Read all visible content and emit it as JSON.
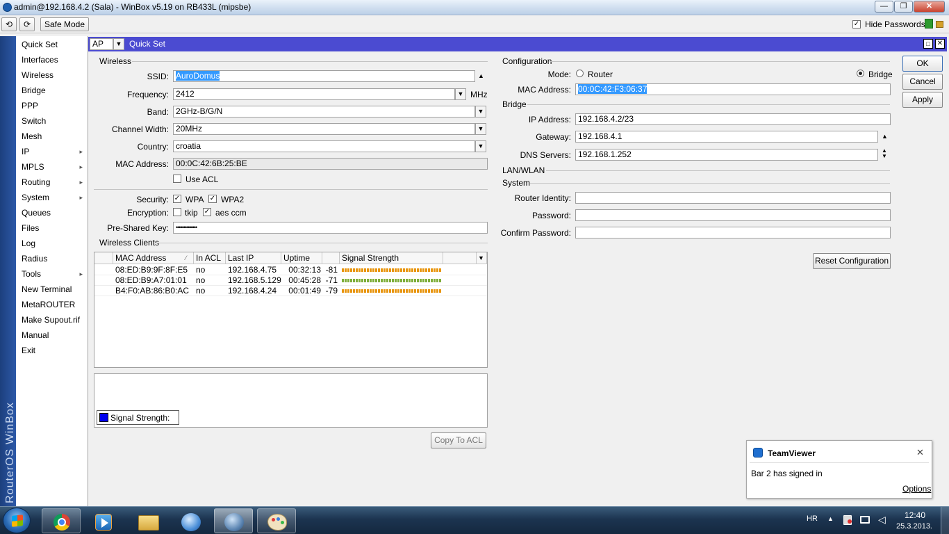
{
  "window": {
    "title": "admin@192.168.4.2 (Sala) - WinBox v5.19 on RB433L (mipsbe)"
  },
  "toolbar": {
    "undo": "⟲",
    "redo": "⟳",
    "safe_mode": "Safe Mode",
    "hide_passwords": "Hide Passwords",
    "hide_passwords_checked": true
  },
  "sidebar": {
    "brand": "RouterOS WinBox",
    "items": [
      {
        "label": "Quick Set",
        "sub": false
      },
      {
        "label": "Interfaces",
        "sub": false
      },
      {
        "label": "Wireless",
        "sub": false
      },
      {
        "label": "Bridge",
        "sub": false
      },
      {
        "label": "PPP",
        "sub": false
      },
      {
        "label": "Switch",
        "sub": false
      },
      {
        "label": "Mesh",
        "sub": false
      },
      {
        "label": "IP",
        "sub": true
      },
      {
        "label": "MPLS",
        "sub": true
      },
      {
        "label": "Routing",
        "sub": true
      },
      {
        "label": "System",
        "sub": true
      },
      {
        "label": "Queues",
        "sub": false
      },
      {
        "label": "Files",
        "sub": false
      },
      {
        "label": "Log",
        "sub": false
      },
      {
        "label": "Radius",
        "sub": false
      },
      {
        "label": "Tools",
        "sub": true
      },
      {
        "label": "New Terminal",
        "sub": false
      },
      {
        "label": "MetaROUTER",
        "sub": false
      },
      {
        "label": "Make Supout.rif",
        "sub": false
      },
      {
        "label": "Manual",
        "sub": false
      },
      {
        "label": "Exit",
        "sub": false
      }
    ]
  },
  "quickset": {
    "mode_select": "AP",
    "title": "Quick Set",
    "buttons": {
      "ok": "OK",
      "cancel": "Cancel",
      "apply": "Apply",
      "reset": "Reset Configuration",
      "copy_acl": "Copy To ACL"
    },
    "wireless": {
      "section": "Wireless",
      "ssid_label": "SSID:",
      "ssid": "AuroDomus",
      "frequency_label": "Frequency:",
      "frequency": "2412",
      "frequency_unit": "MHz",
      "band_label": "Band:",
      "band": "2GHz-B/G/N",
      "channel_width_label": "Channel Width:",
      "channel_width": "20MHz",
      "country_label": "Country:",
      "country": "croatia",
      "mac_label": "MAC Address:",
      "mac": "00:0C:42:6B:25:BE",
      "use_acl": "Use ACL",
      "use_acl_checked": false,
      "security_label": "Security:",
      "wpa": "WPA",
      "wpa_checked": true,
      "wpa2": "WPA2",
      "wpa2_checked": true,
      "encryption_label": "Encryption:",
      "tkip": "tkip",
      "tkip_checked": false,
      "aes": "aes ccm",
      "aes_checked": true,
      "psk_label": "Pre-Shared Key:",
      "psk": "••••••••••••••"
    },
    "clients": {
      "section": "Wireless Clients",
      "columns": [
        "MAC Address",
        "In ACL",
        "Last IP",
        "Uptime",
        "",
        "Signal Strength"
      ],
      "rows": [
        {
          "mac": "08:ED:B9:9F:8F:E5",
          "acl": "no",
          "ip": "192.168.4.75",
          "uptime": "00:32:13",
          "signal": "-81",
          "color": "#e8950f"
        },
        {
          "mac": "08:ED:B9:A7:01:01",
          "acl": "no",
          "ip": "192.168.5.129",
          "uptime": "00:45:28",
          "signal": "-71",
          "color": "#7fae3b"
        },
        {
          "mac": "B4:F0:AB:86:B0:AC",
          "acl": "no",
          "ip": "192.168.4.24",
          "uptime": "00:01:49",
          "signal": "-79",
          "color": "#e8950f"
        }
      ],
      "graph_legend": "Signal Strength:",
      "graph_color": "#0000ee"
    },
    "configuration": {
      "section": "Configuration",
      "mode_label": "Mode:",
      "router": "Router",
      "bridge": "Bridge",
      "mode_selected": "Bridge",
      "mac_label": "MAC Address:",
      "mac": "00:0C:42:F3:06:37"
    },
    "bridge": {
      "section": "Bridge",
      "ip_label": "IP Address:",
      "ip": "192.168.4.2/23",
      "gateway_label": "Gateway:",
      "gateway": "192.168.4.1",
      "dns_label": "DNS Servers:",
      "dns": "192.168.1.252"
    },
    "lan_wlan": {
      "section": "LAN/WLAN"
    },
    "system": {
      "section": "System",
      "identity_label": "Router Identity:",
      "identity": "",
      "password_label": "Password:",
      "password": "",
      "confirm_label": "Confirm Password:",
      "confirm": ""
    }
  },
  "teamviewer": {
    "title": "TeamViewer",
    "message": "Bar 2 has signed in",
    "options": "Options"
  },
  "taskbar": {
    "apps": [
      "chrome-icon",
      "media-player-icon",
      "explorer-folder-icon",
      "thunderbird-icon",
      "winbox-icon",
      "paint-icon"
    ],
    "lang": "HR",
    "time": "12:40",
    "date": "25.3.2013."
  }
}
